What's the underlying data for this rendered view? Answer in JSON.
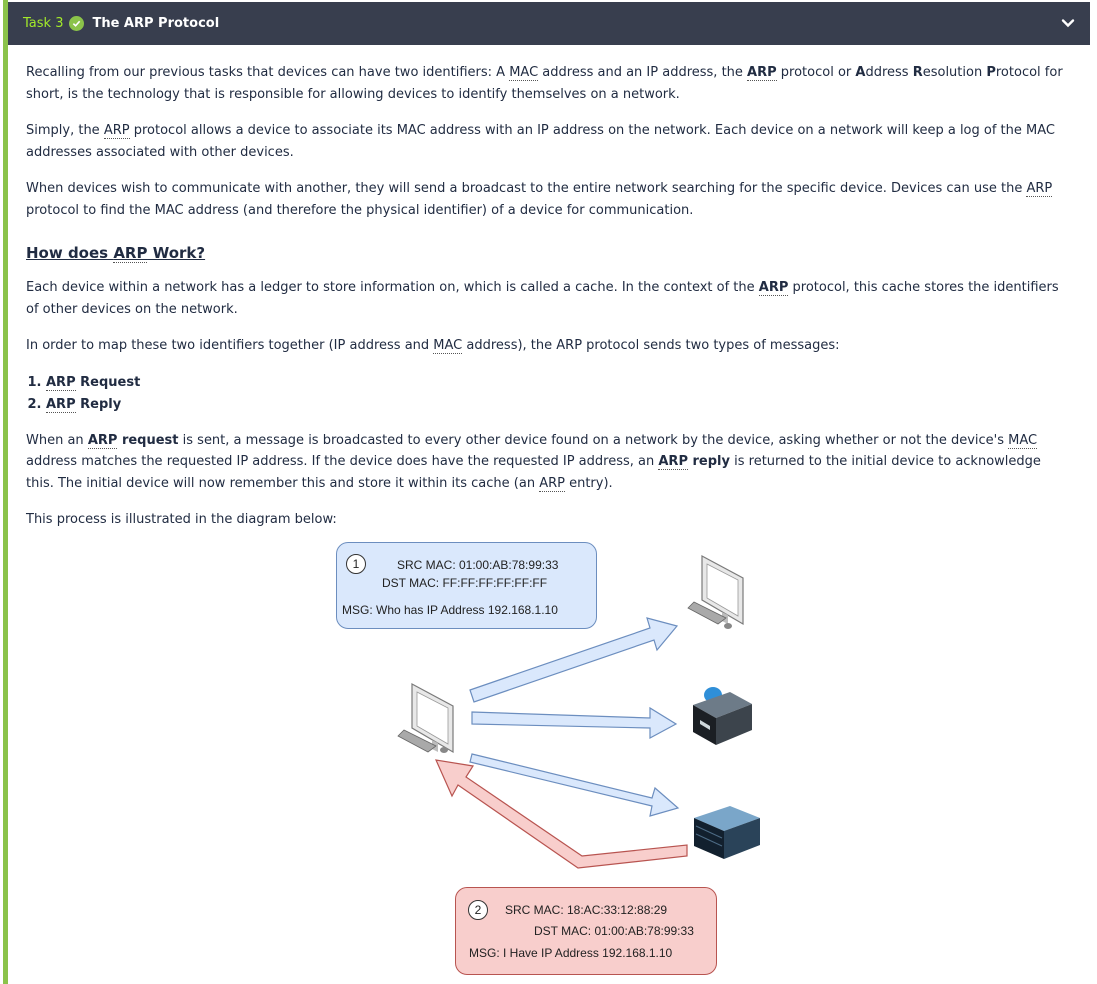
{
  "header": {
    "task_number": "Task 3",
    "title": "The ARP Protocol",
    "accent": "#8bc34a",
    "bar_color": "#383e4e"
  },
  "content": {
    "p1": [
      "Recalling from our previous tasks that devices can have two identifiers: A ",
      "MAC",
      " address and an IP address, the ",
      "ARP",
      " protocol or ",
      "A",
      "ddress ",
      "R",
      "esolution ",
      "P",
      "rotocol for short, is the technology that is responsible for allowing devices to identify themselves on a network."
    ],
    "p2": [
      "Simply, the ",
      "ARP",
      " protocol allows a device to associate its MAC address with an IP address on the network. Each device on a network will keep a log of the MAC addresses associated with other devices."
    ],
    "p3": [
      "When devices wish to communicate with another, they will send a broadcast to the entire network searching for the specific device. Devices can use the ",
      "ARP",
      " protocol to find the MAC address (and therefore the physical identifier) of a device for communication."
    ],
    "heading": [
      "How does ",
      "ARP",
      " Work?"
    ],
    "p4": [
      "Each device within a network has a ledger to store information on, which is called a cache. In the context of the ",
      "ARP",
      " protocol, this cache stores the identifiers of other devices on the network."
    ],
    "p5": [
      "In order to map these two identifiers together (IP address and ",
      "MAC",
      " address), the ARP protocol sends two types of messages:"
    ],
    "list": [
      {
        "abbr": "ARP",
        "rest": " Request"
      },
      {
        "abbr": "ARP",
        "rest": " Reply"
      }
    ],
    "p6": [
      "When an ",
      "ARP",
      " request",
      " is sent, a message is broadcasted to every other device found on a network by the device, asking whether or not the device's ",
      "MAC",
      " address matches the requested IP address. If the device does have the requested IP address, an ",
      "ARP",
      " reply",
      " is returned to the initial device to acknowledge this. The initial device will now remember this and store it within its cache (an ",
      "ARP",
      " entry)."
    ],
    "p7": "This process is illustrated in the diagram below:"
  },
  "diagram": {
    "request": {
      "number": "1",
      "src": "SRC MAC: 01:00:AB:78:99:33",
      "dst": "DST MAC: FF:FF:FF:FF:FF:FF",
      "msg": "MSG: Who has IP Address 192.168.1.10"
    },
    "reply": {
      "number": "2",
      "src": "SRC MAC: 18:AC:33:12:88:29",
      "dst": "DST MAC: 01:00:AB:78:99:33",
      "msg": "MSG: I Have IP Address 192.168.1.10"
    },
    "colors": {
      "request_fill": "#dae8fc",
      "request_stroke": "#6c8ebf",
      "reply_fill": "#f8cecc",
      "reply_stroke": "#b85450"
    },
    "icons": [
      "sender-computer-icon",
      "target-computer-icon",
      "printer-icon",
      "server-icon"
    ]
  }
}
